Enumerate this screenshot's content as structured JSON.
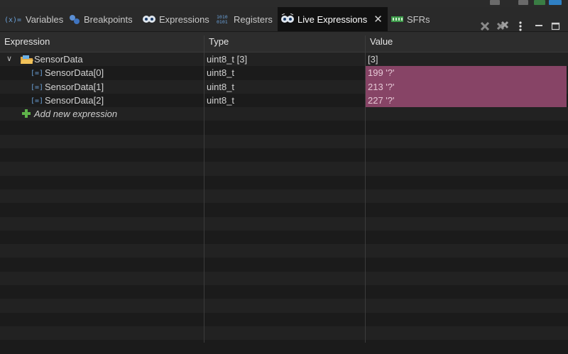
{
  "tabs": [
    {
      "label": "Variables",
      "icon": "variables-icon",
      "active": false
    },
    {
      "label": "Breakpoints",
      "icon": "breakpoints-icon",
      "active": false
    },
    {
      "label": "Expressions",
      "icon": "expressions-icon",
      "active": false
    },
    {
      "label": "Registers",
      "icon": "registers-icon",
      "active": false
    },
    {
      "label": "Live Expressions",
      "icon": "live-expressions-icon",
      "active": true
    },
    {
      "label": "SFRs",
      "icon": "sfrs-icon",
      "active": false
    }
  ],
  "tab_icon_text": {
    "variables": "(x)=",
    "registers": "1010\n0101"
  },
  "toolbar": {
    "remove": "remove-icon",
    "remove_all": "remove-all-icon",
    "menu": "view-menu-icon",
    "minimize": "minimize-icon",
    "maximize": "maximize-icon"
  },
  "columns": {
    "expression": "Expression",
    "type": "Type",
    "value": "Value"
  },
  "rows": [
    {
      "expression": "SensorData",
      "type": "uint8_t [3]",
      "value": "[3]",
      "expanded": true,
      "level": 0,
      "highlight": false
    },
    {
      "expression": "SensorData[0]",
      "type": "uint8_t",
      "value": "199 '?'",
      "level": 1,
      "highlight": true
    },
    {
      "expression": "SensorData[1]",
      "type": "uint8_t",
      "value": "213 '?'",
      "level": 1,
      "highlight": true
    },
    {
      "expression": "SensorData[2]",
      "type": "uint8_t",
      "value": "227 '?'",
      "level": 1,
      "highlight": true
    }
  ],
  "add_expression": "Add new expression",
  "colors": {
    "changed_value_bg": "#874466",
    "active_tab_bg": "#111111",
    "panel_bg": "#1e1e1e"
  }
}
